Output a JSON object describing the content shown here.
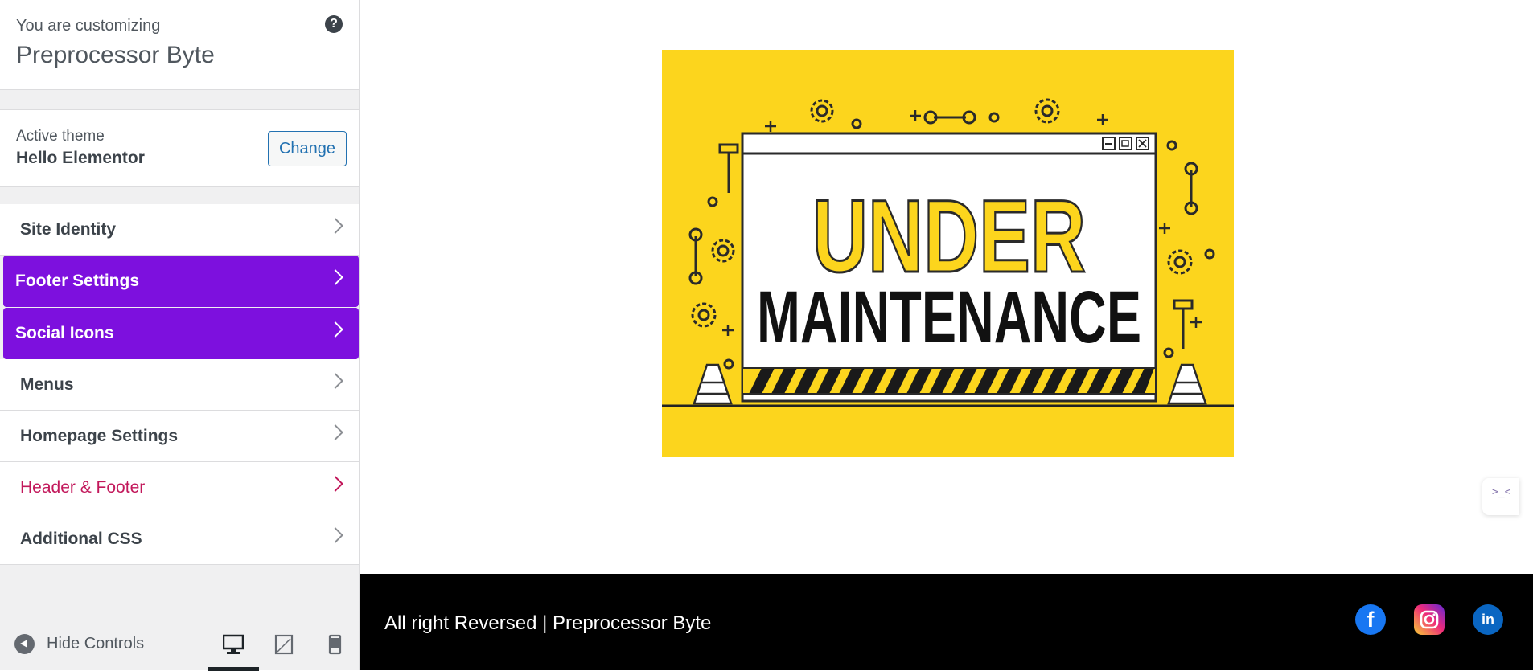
{
  "sidebar": {
    "header": {
      "label": "You are customizing",
      "title": "Preprocessor Byte",
      "help_icon": "?"
    },
    "theme": {
      "label": "Active theme",
      "name": "Hello Elementor",
      "change_label": "Change"
    },
    "menu": [
      {
        "label": "Site Identity"
      },
      {
        "label": "Footer Settings"
      },
      {
        "label": "Social Icons"
      },
      {
        "label": "Menus"
      },
      {
        "label": "Homepage Settings"
      },
      {
        "label": "Header & Footer"
      },
      {
        "label": "Additional CSS"
      }
    ],
    "footer": {
      "hide_label": "Hide Controls"
    },
    "colors": {
      "highlight": "#7d10de",
      "accent_link": "#c2185b"
    }
  },
  "preview": {
    "hero": {
      "line1": "UNDER",
      "line2": "MAINTENANCE",
      "background": "#fcd51d"
    },
    "edge_tab": ">_<",
    "footer": {
      "copyright": "All right Reversed | Preprocessor Byte",
      "social": [
        "facebook-icon",
        "instagram-icon",
        "linkedin-icon"
      ]
    }
  }
}
